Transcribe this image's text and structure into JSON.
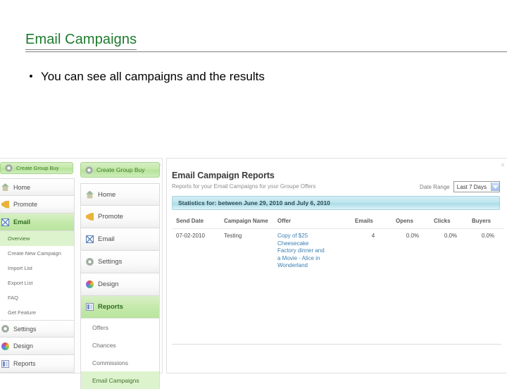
{
  "slide": {
    "title": "Email Campaigns",
    "bullet_marker": "•",
    "bullet_text": "You can see all campaigns and the results",
    "title_color": "#1d7a2e"
  },
  "screenshot": {
    "menu_a": {
      "cta_label": "Create Group Buy",
      "items": [
        {
          "label": "Home",
          "icon": "home-icon",
          "active": false
        },
        {
          "label": "Promote",
          "icon": "megaphone-icon",
          "active": false
        },
        {
          "label": "Email",
          "icon": "envelope-icon",
          "active": true
        }
      ],
      "sub_items": [
        {
          "label": "Overview",
          "active": true
        },
        {
          "label": "Create New Campaign",
          "active": false
        },
        {
          "label": "Import List",
          "active": false
        },
        {
          "label": "Export List",
          "active": false
        },
        {
          "label": "FAQ",
          "active": false
        },
        {
          "label": "Get Feature",
          "active": false
        }
      ],
      "items_after": [
        {
          "label": "Settings",
          "icon": "gear-icon",
          "active": false
        },
        {
          "label": "Design",
          "icon": "palette-icon",
          "active": false
        },
        {
          "label": "Reports",
          "icon": "report-icon",
          "active": false
        }
      ]
    },
    "menu_b": {
      "cta_label": "Create Group Buy",
      "items": [
        {
          "label": "Home",
          "icon": "home-icon",
          "active": false
        },
        {
          "label": "Promote",
          "icon": "megaphone-icon",
          "active": false
        },
        {
          "label": "Email",
          "icon": "envelope-icon",
          "active": false
        },
        {
          "label": "Settings",
          "icon": "gear-icon",
          "active": false
        },
        {
          "label": "Design",
          "icon": "palette-icon",
          "active": false
        },
        {
          "label": "Reports",
          "icon": "report-icon",
          "active": true
        }
      ],
      "sub_items": [
        {
          "label": "Offers",
          "active": false
        },
        {
          "label": "Chances",
          "active": false
        },
        {
          "label": "Commissions",
          "active": false
        },
        {
          "label": "Email Campaigns",
          "active": true
        }
      ]
    },
    "panel": {
      "title": "Email Campaign Reports",
      "subtitle": "Reports for your Email Campaigns for your Groupe Offers",
      "date_range_label": "Date Range",
      "date_range_value": "Last 7 Days",
      "stats_bar": "Statistics for: between June 29, 2010 and July 6, 2010",
      "columns": [
        "Send Date",
        "Campaign Name",
        "Offer",
        "Emails",
        "Opens",
        "Clicks",
        "Buyers"
      ],
      "rows": [
        {
          "send_date": "07-02-2010",
          "campaign_name": "Testing",
          "offer_lines": [
            "Copy of $25",
            "Cheesecake",
            "Factory dinner and",
            "a Movie - Alice in",
            "Wonderland"
          ],
          "emails": "4",
          "opens": "0.0%",
          "clicks": "0.0%",
          "buyers": "0.0%"
        }
      ]
    }
  }
}
